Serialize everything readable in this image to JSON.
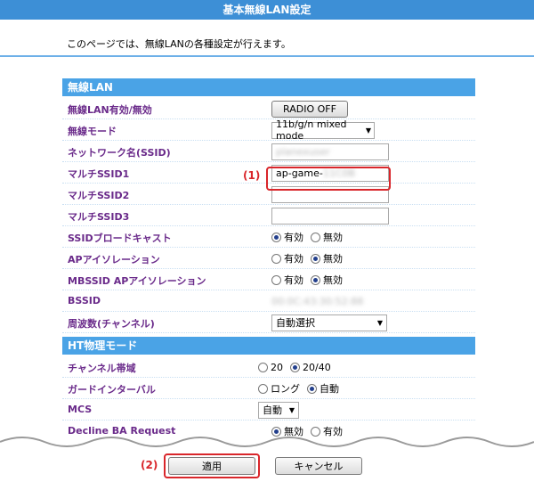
{
  "page": {
    "title": "基本無線LAN設定",
    "intro": "このページでは、無線LANの各種設定が行えます。"
  },
  "wireless_section": {
    "header": "無線LAN",
    "radio_label": "無線LAN有効/無効",
    "radio_button": "RADIO OFF",
    "mode_label": "無線モード",
    "mode_value": "11b/g/n mixed mode",
    "ssid_label": "ネットワーク名(SSID)",
    "ssid_value": "planexuser",
    "multi1_label": "マルチSSID1",
    "multi1_value": "ap-game-",
    "multi1_blurred": "11C0B",
    "multi2_label": "マルチSSID2",
    "multi3_label": "マルチSSID3",
    "broadcast_label": "SSIDブロードキャスト",
    "broadcast_options": [
      "有効",
      "無効"
    ],
    "broadcast_selected": "有効",
    "ap_isolation_label": "APアイソレーション",
    "ap_isolation_options": [
      "有効",
      "無効"
    ],
    "ap_isolation_selected": "無効",
    "mbssid_label": "MBSSID APアイソレーション",
    "mbssid_options": [
      "有効",
      "無効"
    ],
    "mbssid_selected": "無効",
    "bssid_label": "BSSID",
    "bssid_value": "00:0C:43:30:52:88",
    "channel_label": "周波数(チャンネル)",
    "channel_value": "自動選択"
  },
  "ht_section": {
    "header": "HT物理モード",
    "bandwidth_label": "チャンネル帯域",
    "bandwidth_options": [
      "20",
      "20/40"
    ],
    "bandwidth_selected": "20/40",
    "guard_label": "ガードインターバル",
    "guard_options": [
      "ロング",
      "自動"
    ],
    "guard_selected": "自動",
    "mcs_label": "MCS",
    "mcs_value": "自動",
    "decline_label": "Decline BA Request",
    "decline_options": [
      "無効",
      "有効"
    ],
    "decline_selected": "無効"
  },
  "annotations": {
    "one": "(1)",
    "two": "(2)"
  },
  "footer": {
    "apply": "適用",
    "cancel": "キャンセル"
  },
  "colors": {
    "header_blue": "#4aa3e6",
    "label_purple": "#6a2a8a",
    "annotation_red": "#d9262b"
  }
}
